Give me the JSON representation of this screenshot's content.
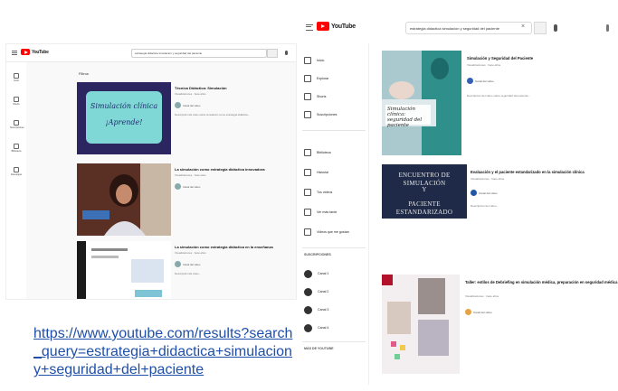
{
  "left_screenshot": {
    "logo_text": "YouTube",
    "search_query": "estrategia didactica simulacion y seguridad del paciente",
    "rail": [
      {
        "label": "Inicio",
        "icon": "home-icon"
      },
      {
        "label": "Shorts",
        "icon": "shorts-icon"
      },
      {
        "label": "Suscripciones",
        "icon": "subscriptions-icon"
      },
      {
        "label": "Biblioteca",
        "icon": "library-icon"
      },
      {
        "label": "Descargas",
        "icon": "download-icon"
      }
    ],
    "filter_label": "Filtros",
    "results": [
      {
        "title": "Técnica Didáctica: Simulación",
        "meta": "Visualizaciones · hace años",
        "channel": "Canal del video",
        "description": "Descripción del video sobre simulación como estrategia didáctica...",
        "thumb_text_line1": "Simulación clínica",
        "thumb_text_line2": "¡Aprende!"
      },
      {
        "title": "La simulación como estrategia didáctica innovadora",
        "meta": "Visualizaciones · hace años",
        "channel": "Canal del video",
        "description": ""
      },
      {
        "title": "La simulación como estrategia didáctica en la enseñanza",
        "meta": "Visualizaciones · hace años",
        "channel": "Canal del video",
        "description": "Descripción del video..."
      }
    ]
  },
  "link": {
    "line1": "https://www.youtube.com/results?search",
    "line2": "_query=estrategia+didactica+simulacion",
    "line3": "y+seguridad+del+paciente"
  },
  "right_screenshot": {
    "logo_text": "YouTube",
    "search_query": "estrategia didactica simulacion y seguridad del paciente",
    "rail": [
      {
        "label": "Inicio",
        "icon": "home-icon"
      },
      {
        "label": "Explorar",
        "icon": "explore-icon"
      },
      {
        "label": "Shorts",
        "icon": "shorts-icon"
      },
      {
        "label": "Suscripciones",
        "icon": "subscriptions-icon"
      },
      {
        "label": "Biblioteca",
        "icon": "library-icon"
      },
      {
        "label": "Historial",
        "icon": "history-icon"
      },
      {
        "label": "Tus videos",
        "icon": "your-videos-icon"
      },
      {
        "label": "Ver más tarde",
        "icon": "watch-later-icon"
      },
      {
        "label": "Videos que me gustan",
        "icon": "liked-icon"
      }
    ],
    "subscriptions_heading": "SUSCRIPCIONES",
    "subscriptions": [
      {
        "label": "Canal 1"
      },
      {
        "label": "Canal 2"
      },
      {
        "label": "Canal 3"
      },
      {
        "label": "Canal 4"
      }
    ],
    "more_heading": "MÁS DE YOUTUBE",
    "results": [
      {
        "title": "Simulación y Seguridad del Paciente",
        "meta": "Visualizaciones · hace años",
        "channel": "Canal del video",
        "description": "Descripción del video sobre seguridad del paciente...",
        "thumb_text": "Simulación clínica: seguridad del paciente"
      },
      {
        "title": "Evaluación y el paciente estandarizado en la simulación clínica",
        "meta": "Visualizaciones · hace años",
        "channel": "Canal del video",
        "description": "Descripción del video...",
        "thumb_text_line1": "ENCUENTRO DE SIMULACIÓN",
        "thumb_text_line2": "Y",
        "thumb_text_line3": "PACIENTE ESTANDARIZADO"
      },
      {
        "title": "Taller: estilos de Debriefing en simulación médica, preparación en seguridad médica",
        "meta": "Visualizaciones · hace años",
        "channel": "Canal del video",
        "description": ""
      }
    ]
  }
}
